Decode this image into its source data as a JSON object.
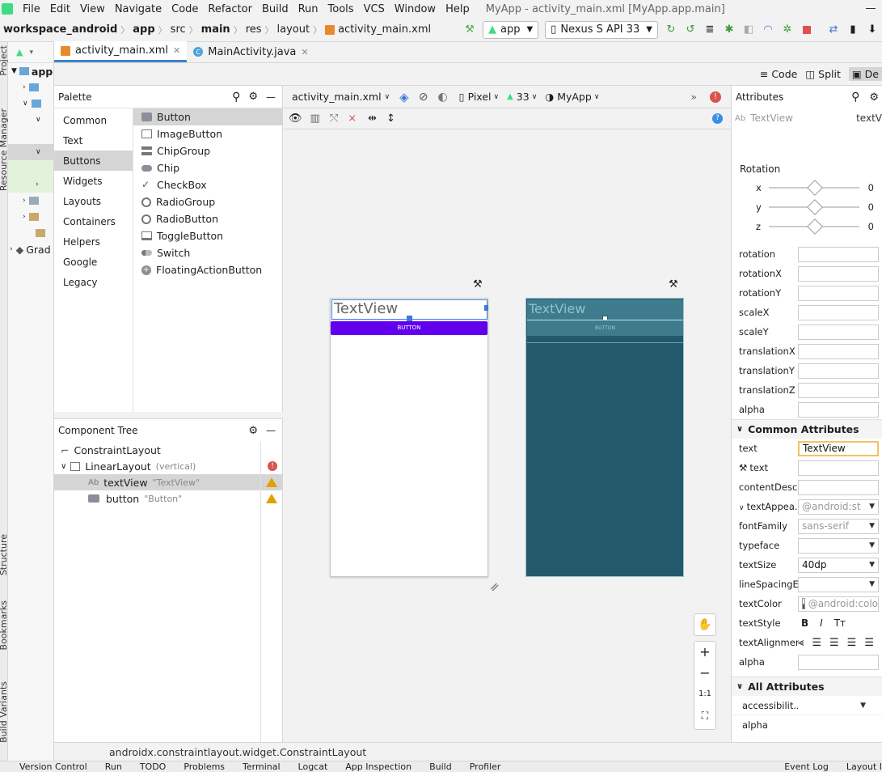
{
  "menu": {
    "items": [
      "File",
      "Edit",
      "View",
      "Navigate",
      "Code",
      "Refactor",
      "Build",
      "Run",
      "Tools",
      "VCS",
      "Window",
      "Help"
    ],
    "window_title": "MyApp - activity_main.xml [MyApp.app.main]"
  },
  "nav": {
    "crumbs": [
      "workspace_android",
      "app",
      "src",
      "main",
      "res",
      "layout",
      "activity_main.xml"
    ],
    "run_config": "app",
    "device": "Nexus S API 33"
  },
  "left_strip": {
    "project": "Project",
    "resource_manager": "Resource Manager",
    "structure": "Structure",
    "bookmarks": "Bookmarks",
    "build_variants": "Build Variants"
  },
  "project_tree": {
    "root": "app",
    "gradle": "Grad"
  },
  "tabs": [
    {
      "label": "activity_main.xml",
      "active": true
    },
    {
      "label": "MainActivity.java",
      "active": false
    }
  ],
  "modes": {
    "code": "Code",
    "split": "Split",
    "design": "De"
  },
  "palette": {
    "title": "Palette",
    "categories": [
      "Common",
      "Text",
      "Buttons",
      "Widgets",
      "Layouts",
      "Containers",
      "Helpers",
      "Google",
      "Legacy"
    ],
    "selected_category": "Buttons",
    "items": [
      "Button",
      "ImageButton",
      "ChipGroup",
      "Chip",
      "CheckBox",
      "RadioGroup",
      "RadioButton",
      "ToggleButton",
      "Switch",
      "FloatingActionButton"
    ]
  },
  "component_tree": {
    "title": "Component Tree",
    "rows": [
      {
        "name": "ConstraintLayout",
        "hint": ""
      },
      {
        "name": "LinearLayout",
        "hint": "(vertical)"
      },
      {
        "name": "textView",
        "hint": "\"TextView\""
      },
      {
        "name": "button",
        "hint": "\"Button\""
      }
    ]
  },
  "design_toolbar": {
    "file": "activity_main.xml",
    "device": "Pixel",
    "api": "33",
    "theme": "MyApp"
  },
  "preview": {
    "textview_text": "TextView",
    "button_text": "BUTTON"
  },
  "zoom": {
    "fit": "1:1"
  },
  "attributes": {
    "title": "Attributes",
    "widget_type": "TextView",
    "widget_id": "textV",
    "rotation_title": "Rotation",
    "rotation_axes": [
      {
        "axis": "x",
        "value": "0"
      },
      {
        "axis": "y",
        "value": "0"
      },
      {
        "axis": "z",
        "value": "0"
      }
    ],
    "transform_fields": [
      "rotation",
      "rotationX",
      "rotationY",
      "scaleX",
      "scaleY",
      "translationX",
      "translationY",
      "translationZ",
      "alpha"
    ],
    "common_section": "Common Attributes",
    "common": [
      {
        "label": "text",
        "value": "TextView"
      },
      {
        "label": "text",
        "value": ""
      },
      {
        "label": "contentDesc...",
        "value": ""
      },
      {
        "label": "textAppea...",
        "value": "@android:st"
      },
      {
        "label": "fontFamily",
        "value": "sans-serif"
      },
      {
        "label": "typeface",
        "value": ""
      },
      {
        "label": "textSize",
        "value": "40dp"
      },
      {
        "label": "lineSpacingE...",
        "value": ""
      },
      {
        "label": "textColor",
        "value": "@android:colo"
      },
      {
        "label": "textStyle",
        "value": ""
      },
      {
        "label": "textAlignment",
        "value": ""
      },
      {
        "label": "alpha",
        "value": ""
      }
    ],
    "all_section": "All Attributes",
    "all": [
      {
        "label": "accessibilit...",
        "value": ""
      },
      {
        "label": "alpha",
        "value": ""
      }
    ]
  },
  "status": {
    "path": "androidx.constraintlayout.widget.ConstraintLayout"
  },
  "bottom_tools": [
    "Version Control",
    "Run",
    "TODO",
    "Problems",
    "Terminal",
    "Logcat",
    "App Inspection",
    "Build",
    "Profiler",
    "Event Log",
    "Layout I"
  ],
  "colors": {
    "accent": "#4083c9",
    "button": "#6200ee",
    "blueprint": "#235a6b"
  }
}
